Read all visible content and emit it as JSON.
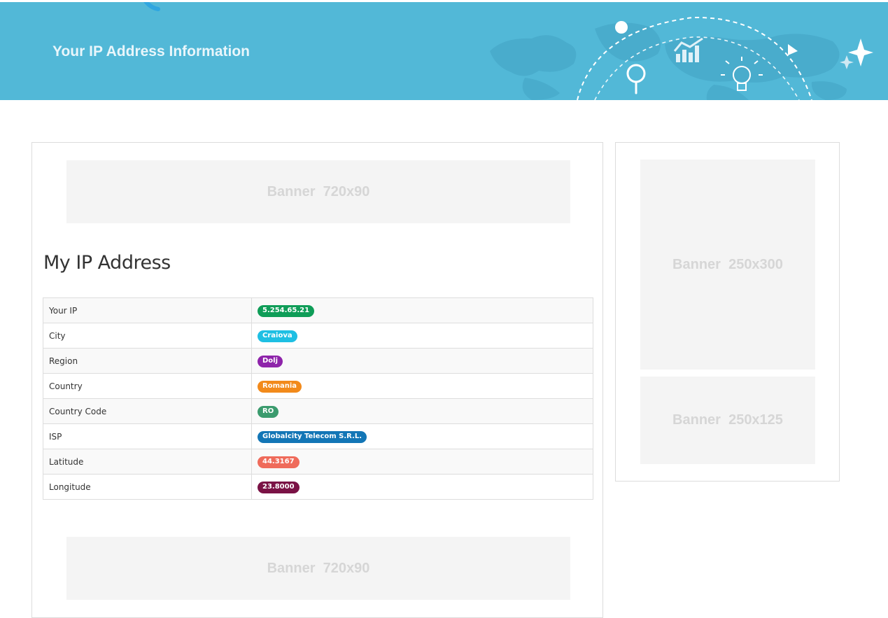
{
  "header": {
    "title": "Your IP Address Information"
  },
  "banners": {
    "top": "Banner  720x90",
    "bottom": "Banner  720x90",
    "side_1": "Banner  250x300",
    "side_2": "Banner  250x125"
  },
  "section": {
    "title": "My IP Address"
  },
  "rows": [
    {
      "label": "Your IP",
      "value": "5.254.65.21",
      "color": "#0f9d58"
    },
    {
      "label": "City",
      "value": "Craiova",
      "color": "#1ebfe3"
    },
    {
      "label": "Region",
      "value": "Dolj",
      "color": "#8e24aa"
    },
    {
      "label": "Country",
      "value": "Romania",
      "color": "#f28a1b"
    },
    {
      "label": "Country Code",
      "value": "RO",
      "color": "#3b9b6e"
    },
    {
      "label": "ISP",
      "value": "Globalcity Telecom S.R.L.",
      "color": "#1376b6"
    },
    {
      "label": "Latitude",
      "value": "44.3167",
      "color": "#ef6b5b"
    },
    {
      "label": "Longitude",
      "value": "23.8000",
      "color": "#7a1245"
    }
  ],
  "icons": {
    "search": "search-icon",
    "chart": "chart-icon",
    "lightbulb": "lightbulb-icon",
    "sparkle": "sparkle-icon",
    "arrow": "arrow-icon",
    "world_map": "world-map-icon"
  }
}
